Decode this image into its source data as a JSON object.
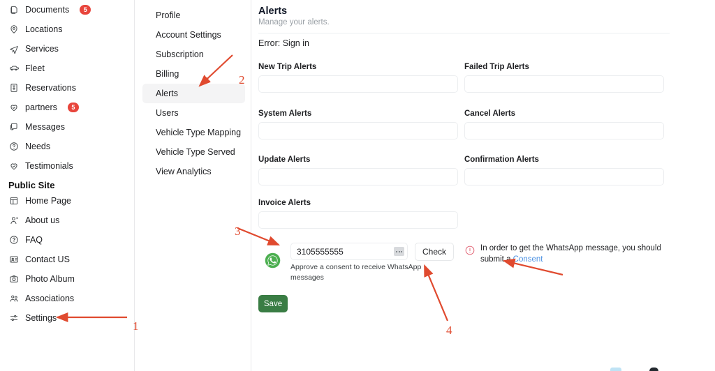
{
  "sidebar": {
    "items": [
      {
        "label": "Documents",
        "icon": "documents-icon",
        "badge": "5"
      },
      {
        "label": "Locations",
        "icon": "location-pin-icon",
        "badge": ""
      },
      {
        "label": "Services",
        "icon": "services-icon",
        "badge": ""
      },
      {
        "label": "Fleet",
        "icon": "car-icon",
        "badge": ""
      },
      {
        "label": "Reservations",
        "icon": "reservations-icon",
        "badge": ""
      },
      {
        "label": "partners",
        "icon": "handshake-icon",
        "badge": "5"
      },
      {
        "label": "Messages",
        "icon": "messages-icon",
        "badge": ""
      },
      {
        "label": "Needs",
        "icon": "question-circle-icon",
        "badge": ""
      },
      {
        "label": "Testimonials",
        "icon": "handshake-icon",
        "badge": ""
      }
    ],
    "section_title": "Public Site",
    "public_items": [
      {
        "label": "Home Page",
        "icon": "layout-icon"
      },
      {
        "label": "About us",
        "icon": "user-icon"
      },
      {
        "label": "FAQ",
        "icon": "question-circle-icon"
      },
      {
        "label": "Contact US",
        "icon": "contact-card-icon"
      },
      {
        "label": "Photo Album",
        "icon": "camera-icon"
      },
      {
        "label": "Associations",
        "icon": "users-group-icon"
      },
      {
        "label": "Settings",
        "icon": "sliders-icon"
      }
    ]
  },
  "settings_nav": {
    "items": [
      {
        "label": "Profile",
        "active": false
      },
      {
        "label": "Account Settings",
        "active": false
      },
      {
        "label": "Subscription",
        "active": false
      },
      {
        "label": "Billing",
        "active": false
      },
      {
        "label": "Alerts",
        "active": true
      },
      {
        "label": "Users",
        "active": false
      },
      {
        "label": "Vehicle Type Mapping",
        "active": false
      },
      {
        "label": "Vehicle Type Served",
        "active": false
      },
      {
        "label": "View Analytics",
        "active": false
      }
    ]
  },
  "main": {
    "title": "Alerts",
    "subtitle": "Manage your alerts.",
    "error": "Error: Sign in",
    "fields": [
      {
        "label": "New Trip Alerts",
        "value": "",
        "placeholder": ""
      },
      {
        "label": "Failed Trip Alerts",
        "value": "",
        "placeholder": ""
      },
      {
        "label": "System Alerts",
        "value": "",
        "placeholder": ""
      },
      {
        "label": "Cancel Alerts",
        "value": "",
        "placeholder": ""
      },
      {
        "label": "Update Alerts",
        "value": "",
        "placeholder": ""
      },
      {
        "label": "Confirmation Alerts",
        "value": "",
        "placeholder": ""
      },
      {
        "label": "Invoice Alerts",
        "value": "",
        "placeholder": ""
      }
    ],
    "whatsapp": {
      "icon": "whatsapp-icon",
      "phone_value": "3105555555",
      "phone_placeholder": "",
      "hint": "Approve a consent to receive WhatsApp messages",
      "check_label": "Check",
      "warn_icon": "warning-circle-icon",
      "note_prefix": "In order to get the WhatsApp message, you should submit a ",
      "note_link": "Consent"
    },
    "save_label": "Save"
  },
  "annotations": {
    "numbers": [
      "1",
      "2",
      "3",
      "4"
    ],
    "color": "#e04a2f"
  }
}
